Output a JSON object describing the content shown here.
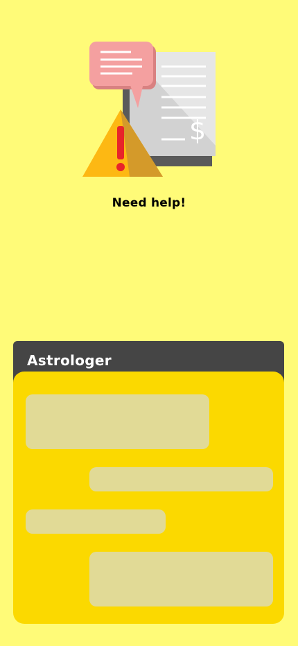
{
  "help": {
    "title": "Need help!"
  },
  "card": {
    "title": "Astrologer",
    "header_color": "#454545",
    "body_color": "#fbd900",
    "placeholder_color": "#e1da96"
  },
  "colors": {
    "background": "#fffb78",
    "warning_yellow": "#fdb813",
    "alert_red": "#e8242a",
    "bubble_pink": "#f4a0a0"
  },
  "icons": [
    "chat-bubble-icon",
    "receipt-icon",
    "dollar-icon",
    "warning-triangle-icon"
  ]
}
